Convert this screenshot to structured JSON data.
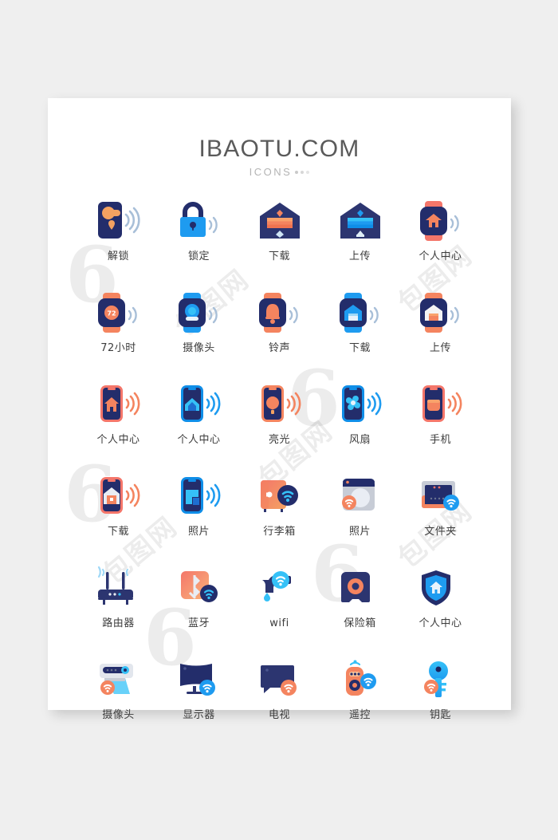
{
  "page": {
    "background_color": "#efefef",
    "card_background": "#ffffff"
  },
  "brand": {
    "title": "IBAOTU.COM",
    "subtitle": "ICONS",
    "title_color": "#5a5a5a",
    "subtitle_color": "#b4b4b4"
  },
  "palette": {
    "navy": "#232d6b",
    "navy_dark": "#1b2460",
    "blue": "#1e9bf0",
    "blue_light": "#35c1f7",
    "blue_bright": "#0f8ee8",
    "orange": "#f4845f",
    "orange_deep": "#ef7350",
    "orange_light": "#f9a26c",
    "coral": "#f4766a",
    "grey_light": "#c7ccd6",
    "label": "#3c3c3c"
  },
  "grid": {
    "columns": 5,
    "rows": 6,
    "items": [
      {
        "label": "解锁",
        "icon": "door-handle-unlock-icon",
        "row": 1,
        "col": 1
      },
      {
        "label": "锁定",
        "icon": "padlock-lock-icon",
        "row": 1,
        "col": 2
      },
      {
        "label": "下载",
        "icon": "garage-download-icon",
        "row": 1,
        "col": 3
      },
      {
        "label": "上传",
        "icon": "garage-upload-icon",
        "row": 1,
        "col": 4
      },
      {
        "label": "个人中心",
        "icon": "smartwatch-home-icon",
        "row": 1,
        "col": 5
      },
      {
        "label": "72小时",
        "icon": "smartwatch-72h-icon",
        "row": 2,
        "col": 1
      },
      {
        "label": "摄像头",
        "icon": "smartwatch-camera-icon",
        "row": 2,
        "col": 2
      },
      {
        "label": "铃声",
        "icon": "smartwatch-bell-icon",
        "row": 2,
        "col": 3
      },
      {
        "label": "下载",
        "icon": "smartwatch-garage-blue-icon",
        "row": 2,
        "col": 4
      },
      {
        "label": "上传",
        "icon": "smartwatch-garage-orange-icon",
        "row": 2,
        "col": 5
      },
      {
        "label": "个人中心",
        "icon": "phone-home-orange-icon",
        "row": 3,
        "col": 1
      },
      {
        "label": "个人中心",
        "icon": "phone-home-blue-icon",
        "row": 3,
        "col": 2
      },
      {
        "label": "亮光",
        "icon": "phone-bulb-icon",
        "row": 3,
        "col": 3
      },
      {
        "label": "风扇",
        "icon": "phone-fan-icon",
        "row": 3,
        "col": 4
      },
      {
        "label": "手机",
        "icon": "phone-blank-icon",
        "row": 3,
        "col": 5
      },
      {
        "label": "下载",
        "icon": "phone-garage-icon",
        "row": 4,
        "col": 1
      },
      {
        "label": "照片",
        "icon": "phone-cast-photo-icon",
        "row": 4,
        "col": 2
      },
      {
        "label": "行李箱",
        "icon": "suitcase-wifi-icon",
        "row": 4,
        "col": 3
      },
      {
        "label": "照片",
        "icon": "washer-photo-wifi-icon",
        "row": 4,
        "col": 4
      },
      {
        "label": "文件夹",
        "icon": "folder-wifi-icon",
        "row": 4,
        "col": 5
      },
      {
        "label": "路由器",
        "icon": "router-icon",
        "row": 5,
        "col": 1
      },
      {
        "label": "蓝牙",
        "icon": "bluetooth-wifi-icon",
        "row": 5,
        "col": 2
      },
      {
        "label": "wifi",
        "icon": "faucet-wifi-icon",
        "row": 5,
        "col": 3
      },
      {
        "label": "保险箱",
        "icon": "safebox-icon",
        "row": 5,
        "col": 4
      },
      {
        "label": "个人中心",
        "icon": "shield-home-icon",
        "row": 5,
        "col": 5
      },
      {
        "label": "摄像头",
        "icon": "scanner-camera-wifi-icon",
        "row": 6,
        "col": 1
      },
      {
        "label": "显示器",
        "icon": "monitor-wifi-icon",
        "row": 6,
        "col": 2
      },
      {
        "label": "电视",
        "icon": "tv-wifi-icon",
        "row": 6,
        "col": 3
      },
      {
        "label": "遥控",
        "icon": "remote-control-wifi-icon",
        "row": 6,
        "col": 4
      },
      {
        "label": "钥匙",
        "icon": "key-wifi-icon",
        "row": 6,
        "col": 5
      }
    ]
  },
  "badges": {
    "watch_72": "72"
  }
}
